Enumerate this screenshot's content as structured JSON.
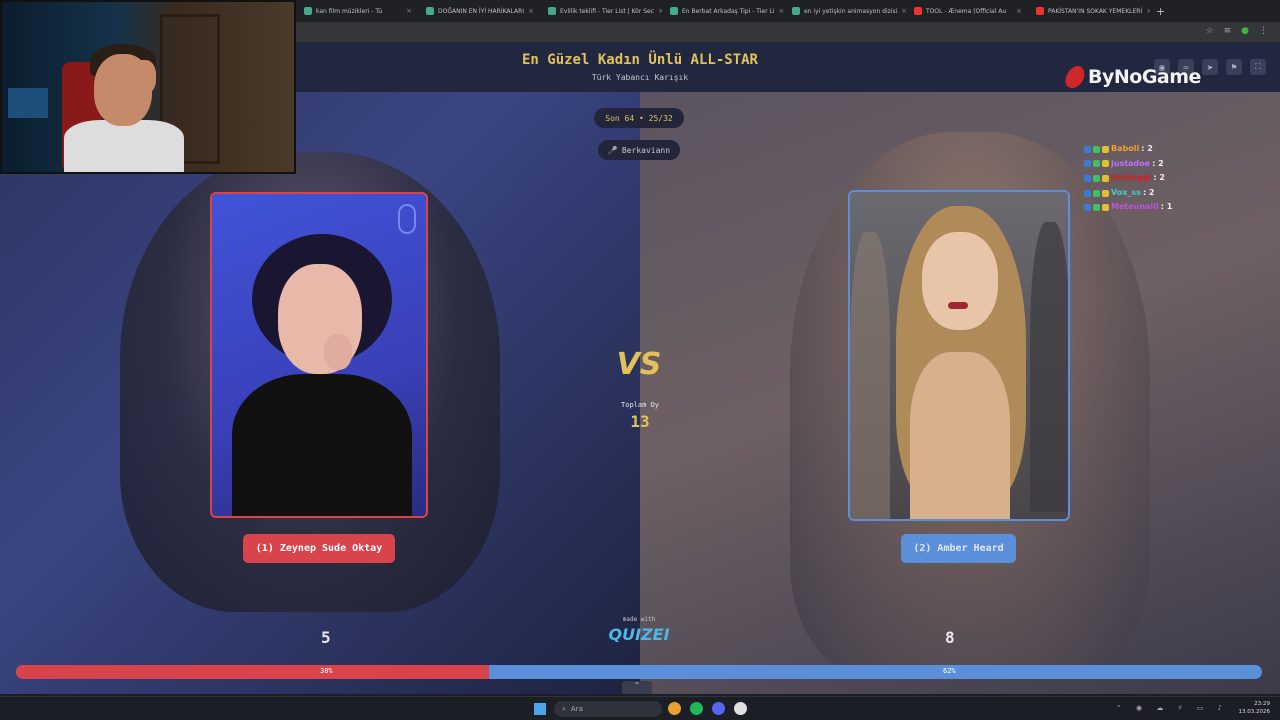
{
  "browser": {
    "tabs": [
      {
        "title": "kan film müzikleri - Tü",
        "icon": "favicon"
      },
      {
        "title": "DOĞANIN EN İYİ HARİKALARI",
        "icon": "favicon"
      },
      {
        "title": "Evlilik teklifi - Tier List | Kör Sec",
        "icon": "favicon"
      },
      {
        "title": "En Berbat Arkadaş Tipi - Tier Li",
        "icon": "favicon"
      },
      {
        "title": "en iyi yetişkin animasyon dizisi",
        "icon": "favicon"
      },
      {
        "title": "TOOL - Ænema (Official Au",
        "icon": "youtube"
      },
      {
        "title": "PAKİSTAN'IN SOKAK YEMEKLERİ",
        "icon": "youtube"
      }
    ],
    "new_tab": "+",
    "tab_close": "×"
  },
  "game": {
    "title": "En Güzel Kadın Ünlü ALL-STAR",
    "subtitle": "Türk Yabancı Karışık",
    "round": "Son 64 • 25/32",
    "username": "Berkaviann",
    "vs": "VS",
    "total_label": "Toplam Oy",
    "total_votes": "13",
    "left": {
      "name": "(1) Zeynep Sude Oktay",
      "votes": "5",
      "percent_label": "38%",
      "percent": 38,
      "color": "#d9434b"
    },
    "right": {
      "name": "(2) Amber Heard",
      "votes": "8",
      "percent_label": "62%",
      "percent": 62,
      "color": "#5b8fd9"
    },
    "made_with": "made with",
    "brand": "QUIZEI",
    "accent": "#e3c15a"
  },
  "overlay": {
    "bynogame": "ByNoGame",
    "chat": [
      {
        "user": "Baboli",
        "count": ": 2",
        "color": "#f0a030"
      },
      {
        "user": "justadoe",
        "count": ": 2",
        "color": "#c070ff"
      },
      {
        "user": "Holdoggi",
        "count": ": 2",
        "color": "#d02020"
      },
      {
        "user": "Vox_ss",
        "count": ": 2",
        "color": "#40d0c0"
      },
      {
        "user": "Meteunal0",
        "count": ": 1",
        "color": "#c050e0"
      }
    ]
  },
  "taskbar": {
    "search_placeholder": "Ara",
    "time": "23:29",
    "date": "13.03.2026"
  }
}
